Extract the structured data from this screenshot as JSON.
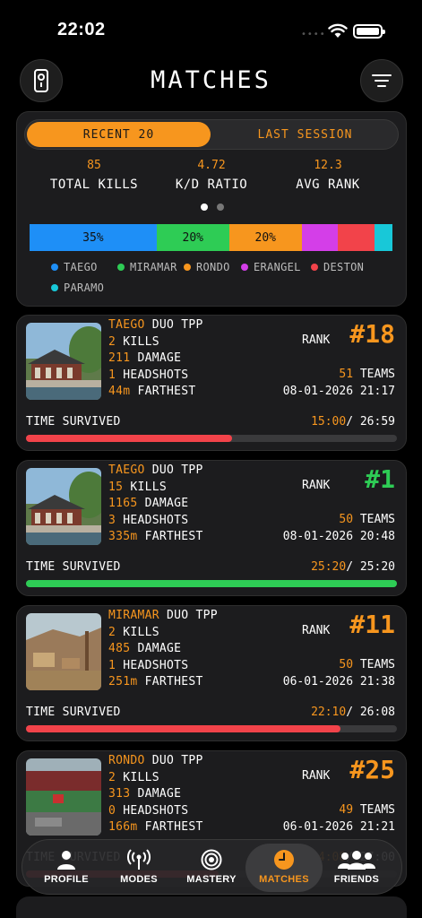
{
  "status_bar": {
    "time": "22:02",
    "dots": "••••"
  },
  "header": {
    "title": "MATCHES"
  },
  "summary": {
    "tabs": [
      "RECENT 20",
      "LAST SESSION"
    ],
    "stats": [
      {
        "value": "85",
        "label": "TOTAL KILLS"
      },
      {
        "value": "4.72",
        "label": "K/D RATIO"
      },
      {
        "value": "12.3",
        "label": "AVG RANK"
      }
    ],
    "distribution": [
      {
        "map": "TAEGO",
        "percent": 35,
        "label": "35%",
        "color": "#1e8ff7"
      },
      {
        "map": "MIRAMAR",
        "percent": 20,
        "label": "20%",
        "color": "#2ecc55"
      },
      {
        "map": "RONDO",
        "percent": 20,
        "label": "20%",
        "color": "#f7961e"
      },
      {
        "map": "ERANGEL",
        "percent": 10,
        "label": "",
        "color": "#d43ee8"
      },
      {
        "map": "DESTON",
        "percent": 10,
        "label": "",
        "color": "#f2434a"
      },
      {
        "map": "PARAMO",
        "percent": 5,
        "label": "",
        "color": "#18c8d8"
      }
    ]
  },
  "matches": [
    {
      "map": "TAEGO",
      "mode": "DUO TPP",
      "kills_value": "2",
      "kills_label": "KILLS",
      "damage_value": "211",
      "damage_label": "DAMAGE",
      "headshots_value": "1",
      "headshots_label": "HEADSHOTS",
      "farthest_value": "44m",
      "farthest_label": "FARTHEST",
      "rank_label": "RANK",
      "rank": "#18",
      "rank_color": "#f7961e",
      "teams_value": "51",
      "teams_label": "TEAMS",
      "date": "08-01-2026 21:17",
      "time_label": "TIME SURVIVED",
      "time_survived": "15:00",
      "time_total": "/ 26:59",
      "progress": 0.556,
      "progress_color": "#f2434a",
      "thumb": "palace"
    },
    {
      "map": "TAEGO",
      "mode": "DUO TPP",
      "kills_value": "15",
      "kills_label": "KILLS",
      "damage_value": "1165",
      "damage_label": "DAMAGE",
      "headshots_value": "3",
      "headshots_label": "HEADSHOTS",
      "farthest_value": "335m",
      "farthest_label": "FARTHEST",
      "rank_label": "RANK",
      "rank": "#1",
      "rank_color": "#2ecc55",
      "teams_value": "50",
      "teams_label": "TEAMS",
      "date": "08-01-2026 20:48",
      "time_label": "TIME SURVIVED",
      "time_survived": "25:20",
      "time_total": "/ 25:20",
      "progress": 1.0,
      "progress_color": "#2ecc55",
      "thumb": "palace"
    },
    {
      "map": "MIRAMAR",
      "mode": "DUO TPP",
      "kills_value": "2",
      "kills_label": "KILLS",
      "damage_value": "485",
      "damage_label": "DAMAGE",
      "headshots_value": "1",
      "headshots_label": "HEADSHOTS",
      "farthest_value": "251m",
      "farthest_label": "FARTHEST",
      "rank_label": "RANK",
      "rank": "#11",
      "rank_color": "#f7961e",
      "teams_value": "50",
      "teams_label": "TEAMS",
      "date": "06-01-2026 21:38",
      "time_label": "TIME SURVIVED",
      "time_survived": "22:10",
      "time_total": "/ 26:08",
      "progress": 0.848,
      "progress_color": "#f2434a",
      "thumb": "desert"
    },
    {
      "map": "RONDO",
      "mode": "DUO TPP",
      "kills_value": "2",
      "kills_label": "KILLS",
      "damage_value": "313",
      "damage_label": "DAMAGE",
      "headshots_value": "0",
      "headshots_label": "HEADSHOTS",
      "farthest_value": "166m",
      "farthest_label": "FARTHEST",
      "rank_label": "RANK",
      "rank": "#25",
      "rank_color": "#f7961e",
      "teams_value": "49",
      "teams_label": "TEAMS",
      "date": "06-01-2026 21:21",
      "time_label": "TIME SURVIVED",
      "time_survived": "14:08",
      "time_total": "/ 27:00",
      "progress": 0.52,
      "progress_color": "#f2434a",
      "thumb": "stadium"
    }
  ],
  "tabbar": {
    "items": [
      {
        "label": "PROFILE",
        "icon": "person-icon"
      },
      {
        "label": "MODES",
        "icon": "broadcast-icon"
      },
      {
        "label": "MASTERY",
        "icon": "target-icon"
      },
      {
        "label": "MATCHES",
        "icon": "clock-icon"
      },
      {
        "label": "FRIENDS",
        "icon": "friends-icon"
      }
    ]
  }
}
